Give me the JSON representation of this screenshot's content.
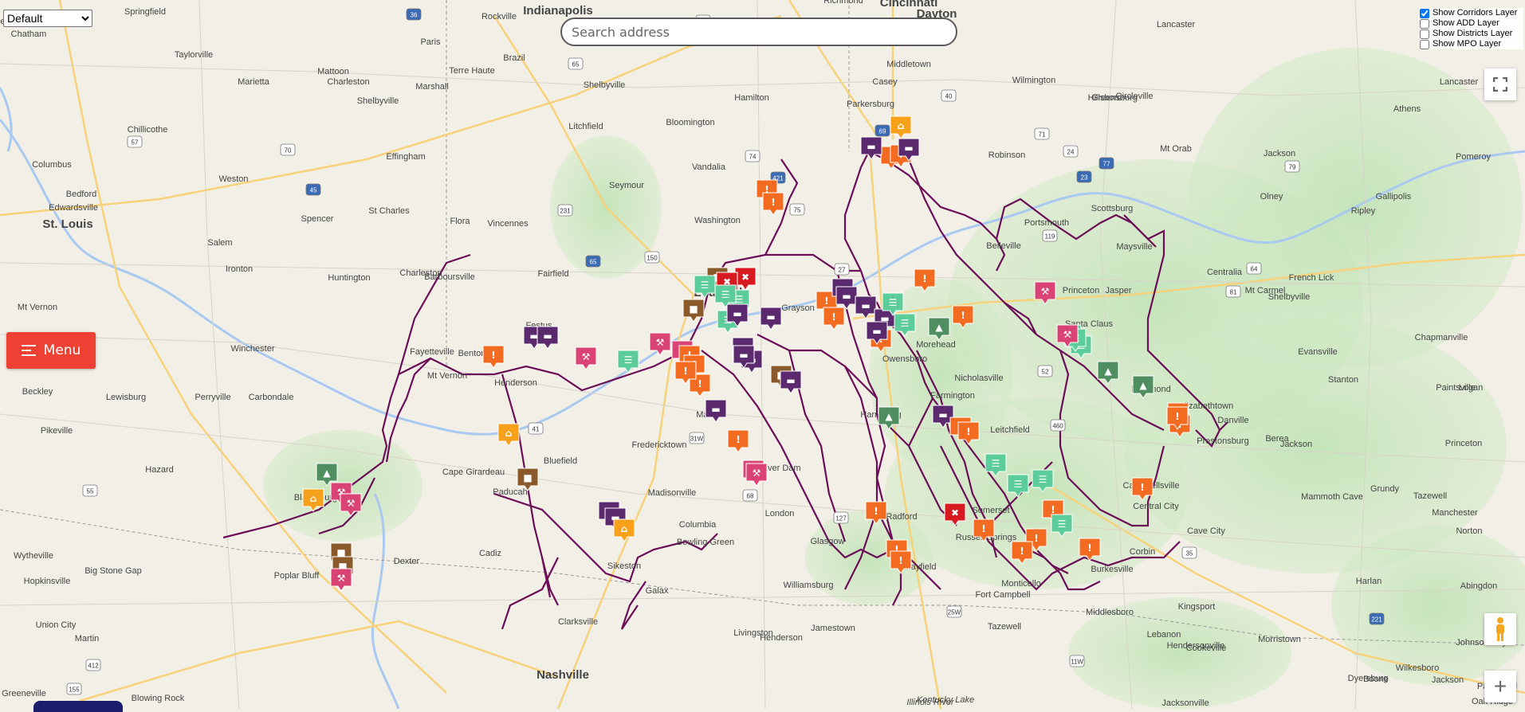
{
  "top_select": {
    "selected": "Default"
  },
  "search": {
    "placeholder": "Search address"
  },
  "layers": [
    {
      "label": "Show Corridors Layer",
      "checked": true
    },
    {
      "label": "Show ADD Layer",
      "checked": false
    },
    {
      "label": "Show Districts Layer",
      "checked": false
    },
    {
      "label": "Show MPO Layer",
      "checked": false
    }
  ],
  "menu_button": {
    "label": "Menu"
  },
  "zoom": {
    "plus": "+"
  },
  "cities": [
    {
      "name": "Indianapolis",
      "major": true
    },
    {
      "name": "Cincinnati",
      "major": true
    },
    {
      "name": "St. Louis",
      "major": true
    },
    {
      "name": "Louisville",
      "major": true
    },
    {
      "name": "Nashville",
      "major": true
    },
    {
      "name": "Dayton",
      "major": true
    },
    {
      "name": "Springfield",
      "major": false
    },
    {
      "name": "Richmond",
      "major": false
    },
    {
      "name": "Lancaster",
      "major": false
    },
    {
      "name": "Glenview",
      "major": false
    },
    {
      "name": "Chatham",
      "major": false
    },
    {
      "name": "Paris",
      "major": false
    },
    {
      "name": "Rockville",
      "major": false
    },
    {
      "name": "Terre Haute",
      "major": false
    },
    {
      "name": "Brazil",
      "major": false
    },
    {
      "name": "Shelbyville",
      "major": false
    },
    {
      "name": "Middletown",
      "major": false
    },
    {
      "name": "Taylorville",
      "major": false
    },
    {
      "name": "Mattoon",
      "major": false
    },
    {
      "name": "Charleston",
      "major": false
    },
    {
      "name": "Marshall",
      "major": false
    },
    {
      "name": "Wilmington",
      "major": false
    },
    {
      "name": "Circleville",
      "major": false
    },
    {
      "name": "Lancaster",
      "major": false
    },
    {
      "name": "Marietta",
      "major": false
    },
    {
      "name": "Shelbyville",
      "major": false
    },
    {
      "name": "Casey",
      "major": false
    },
    {
      "name": "Hamilton",
      "major": false
    },
    {
      "name": "Greensburg",
      "major": false
    },
    {
      "name": "Athens",
      "major": false
    },
    {
      "name": "Parkersburg",
      "major": false
    },
    {
      "name": "Hillsboro",
      "major": false
    },
    {
      "name": "Chillicothe",
      "major": false
    },
    {
      "name": "Litchfield",
      "major": false
    },
    {
      "name": "Bloomington",
      "major": false
    },
    {
      "name": "Columbus",
      "major": false
    },
    {
      "name": "Effingham",
      "major": false
    },
    {
      "name": "Robinson",
      "major": false
    },
    {
      "name": "Mt Orab",
      "major": false
    },
    {
      "name": "Jackson",
      "major": false
    },
    {
      "name": "Pomeroy",
      "major": false
    },
    {
      "name": "Weston",
      "major": false
    },
    {
      "name": "Vandalia",
      "major": false
    },
    {
      "name": "Seymour",
      "major": false
    },
    {
      "name": "Bedford",
      "major": false
    },
    {
      "name": "Edwardsville",
      "major": false
    },
    {
      "name": "St Charles",
      "major": false
    },
    {
      "name": "Olney",
      "major": false
    },
    {
      "name": "Gallipolis",
      "major": false
    },
    {
      "name": "Ripley",
      "major": false
    },
    {
      "name": "Spencer",
      "major": false
    },
    {
      "name": "Flora",
      "major": false
    },
    {
      "name": "Vincennes",
      "major": false
    },
    {
      "name": "Washington",
      "major": false
    },
    {
      "name": "Scottsburg",
      "major": false
    },
    {
      "name": "Portsmouth",
      "major": false
    },
    {
      "name": "Salem",
      "major": false
    },
    {
      "name": "Belleville",
      "major": false
    },
    {
      "name": "Maysville",
      "major": false
    },
    {
      "name": "Ironton",
      "major": false
    },
    {
      "name": "Centralia",
      "major": false
    },
    {
      "name": "French Lick",
      "major": false
    },
    {
      "name": "Huntington",
      "major": false
    },
    {
      "name": "Charleston",
      "major": false
    },
    {
      "name": "Fairfield",
      "major": false
    },
    {
      "name": "Mt Carmel",
      "major": false
    },
    {
      "name": "Jasper",
      "major": false
    },
    {
      "name": "Barboursville",
      "major": false
    },
    {
      "name": "Grayson",
      "major": false
    },
    {
      "name": "Princeton",
      "major": false
    },
    {
      "name": "Shelbyville",
      "major": false
    },
    {
      "name": "Mt Vernon",
      "major": false
    },
    {
      "name": "Festus",
      "major": false
    },
    {
      "name": "Santa Claus",
      "major": false
    },
    {
      "name": "Morehead",
      "major": false
    },
    {
      "name": "Winchester",
      "major": false
    },
    {
      "name": "Benton",
      "major": false
    },
    {
      "name": "Evansville",
      "major": false
    },
    {
      "name": "Chapmanville",
      "major": false
    },
    {
      "name": "Fayetteville",
      "major": false
    },
    {
      "name": "Mt Vernon",
      "major": false
    },
    {
      "name": "Henderson",
      "major": false
    },
    {
      "name": "Owensboro",
      "major": false
    },
    {
      "name": "Nicholasville",
      "major": false
    },
    {
      "name": "Stanton",
      "major": false
    },
    {
      "name": "Logan",
      "major": false
    },
    {
      "name": "Beckley",
      "major": false
    },
    {
      "name": "Farmington",
      "major": false
    },
    {
      "name": "Richmond",
      "major": false
    },
    {
      "name": "Paintsville",
      "major": false
    },
    {
      "name": "Lewisburg",
      "major": false
    },
    {
      "name": "Perryville",
      "major": false
    },
    {
      "name": "Carbondale",
      "major": false
    },
    {
      "name": "Marion",
      "major": false
    },
    {
      "name": "Harrisburg",
      "major": false
    },
    {
      "name": "Elizabethtown",
      "major": false
    },
    {
      "name": "Danville",
      "major": false
    },
    {
      "name": "Prestonsburg",
      "major": false
    },
    {
      "name": "Pikeville",
      "major": false
    },
    {
      "name": "Fredericktown",
      "major": false
    },
    {
      "name": "Leitchfield",
      "major": false
    },
    {
      "name": "Berea",
      "major": false
    },
    {
      "name": "Jackson",
      "major": false
    },
    {
      "name": "Princeton",
      "major": false
    },
    {
      "name": "Bluefield",
      "major": false
    },
    {
      "name": "Beaver Dam",
      "major": false
    },
    {
      "name": "Campbellsville",
      "major": false
    },
    {
      "name": "Hazard",
      "major": false
    },
    {
      "name": "Cape Girardeau",
      "major": false
    },
    {
      "name": "Madisonville",
      "major": false
    },
    {
      "name": "Mammoth Cave",
      "major": false
    },
    {
      "name": "Grundy",
      "major": false
    },
    {
      "name": "Tazewell",
      "major": false
    },
    {
      "name": "Blacksburg",
      "major": false
    },
    {
      "name": "Paducah",
      "major": false
    },
    {
      "name": "Central City",
      "major": false
    },
    {
      "name": "Manchester",
      "major": false
    },
    {
      "name": "Radford",
      "major": false
    },
    {
      "name": "Somerset",
      "major": false
    },
    {
      "name": "London",
      "major": false
    },
    {
      "name": "Columbia",
      "major": false
    },
    {
      "name": "Cave City",
      "major": false
    },
    {
      "name": "Norton",
      "major": false
    },
    {
      "name": "Wytheville",
      "major": false
    },
    {
      "name": "Sikeston",
      "major": false
    },
    {
      "name": "Bowling Green",
      "major": false
    },
    {
      "name": "Glasgow",
      "major": false
    },
    {
      "name": "Russell Springs",
      "major": false
    },
    {
      "name": "Corbin",
      "major": false
    },
    {
      "name": "Big Stone Gap",
      "major": false
    },
    {
      "name": "Dexter",
      "major": false
    },
    {
      "name": "Cadiz",
      "major": false
    },
    {
      "name": "Hopkinsville",
      "major": false
    },
    {
      "name": "Poplar Bluff",
      "major": false
    },
    {
      "name": "Mayfield",
      "major": false
    },
    {
      "name": "Monticello",
      "major": false
    },
    {
      "name": "Williamsburg",
      "major": false
    },
    {
      "name": "Burkesville",
      "major": false
    },
    {
      "name": "Harlan",
      "major": false
    },
    {
      "name": "Abingdon",
      "major": false
    },
    {
      "name": "Galax",
      "major": false
    },
    {
      "name": "Fort Campbell",
      "major": false
    },
    {
      "name": "Middlesboro",
      "major": false
    },
    {
      "name": "Clarksville",
      "major": false
    },
    {
      "name": "Kingsport",
      "major": false
    },
    {
      "name": "Union City",
      "major": false
    },
    {
      "name": "Martin",
      "major": false
    },
    {
      "name": "Henderson",
      "major": false
    },
    {
      "name": "Livingston",
      "major": false
    },
    {
      "name": "Jamestown",
      "major": false
    },
    {
      "name": "Tazewell",
      "major": false
    },
    {
      "name": "Hendersonville",
      "major": false
    },
    {
      "name": "Lebanon",
      "major": false
    },
    {
      "name": "Cookeville",
      "major": false
    },
    {
      "name": "Morristown",
      "major": false
    },
    {
      "name": "Johnson City",
      "major": false
    },
    {
      "name": "Boone",
      "major": false
    },
    {
      "name": "Wilkesboro",
      "major": false
    },
    {
      "name": "Paragould",
      "major": false
    },
    {
      "name": "Dyersburg",
      "major": false
    },
    {
      "name": "Jackson",
      "major": false
    },
    {
      "name": "Oak Ridge",
      "major": false
    },
    {
      "name": "Greeneville",
      "major": false
    },
    {
      "name": "Blowing Rock",
      "major": false
    },
    {
      "name": "Kentucky Lake",
      "major": false
    },
    {
      "name": "Illinois River",
      "major": false
    },
    {
      "name": "Jacksonville",
      "major": false
    }
  ],
  "route_shields": [
    "36",
    "65",
    "1",
    "70",
    "57",
    "69",
    "74",
    "71",
    "75",
    "64",
    "77",
    "79",
    "81",
    "40",
    "24",
    "65",
    "31W",
    "25W",
    "68",
    "41",
    "45",
    "55",
    "155",
    "412",
    "11W",
    "421",
    "127",
    "27",
    "150",
    "231",
    "23",
    "119",
    "52",
    "460",
    "35",
    "221"
  ],
  "marker_colors": {
    "warning": "#f26b21",
    "construction": "#d94475",
    "traffic": "#5b2a6e",
    "comment": "#5ccc9a",
    "closure": "#d71920",
    "info": "#f7a11b",
    "camera": "#4f8f5f",
    "bus": "#8a5a2b"
  },
  "corridor_color": "#6b0d57"
}
